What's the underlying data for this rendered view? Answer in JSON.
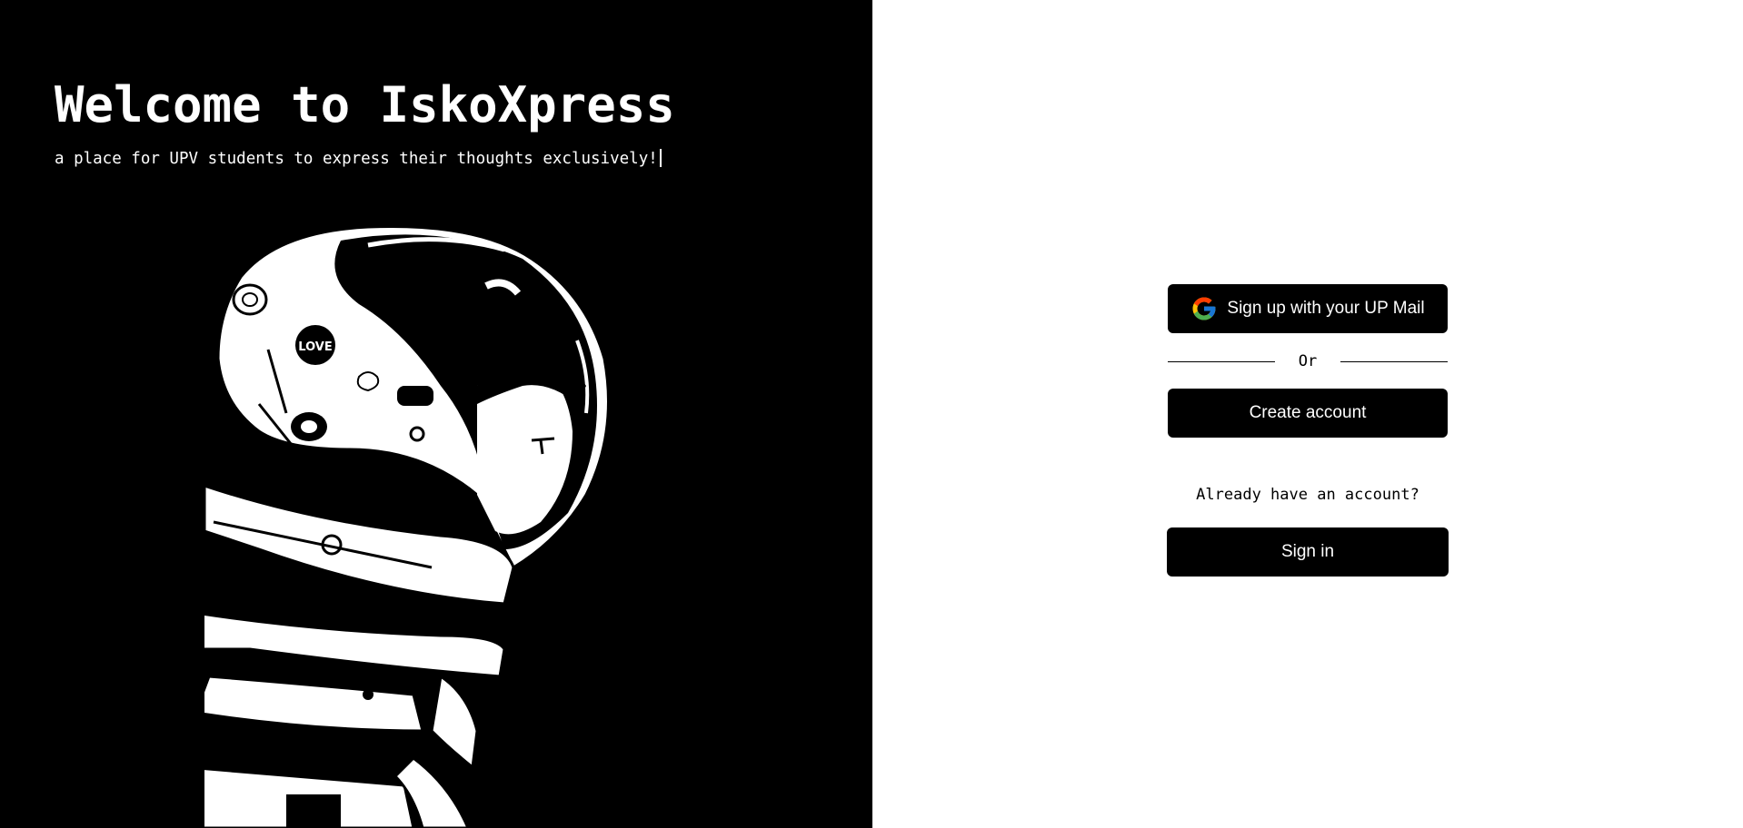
{
  "hero": {
    "title": "Welcome to IskoXpress",
    "subtitle": "a place for UPV students to express their thoughts exclusively!",
    "illustration_text": "LOVE",
    "colors": {
      "background": "#000000",
      "text": "#ffffff"
    }
  },
  "auth": {
    "google_button_label": "Sign up with your UP Mail",
    "google_icon": "google-icon",
    "divider_label": "Or",
    "create_account_label": "Create account",
    "already_have_account_text": "Already have an account?",
    "sign_in_label": "Sign in",
    "colors": {
      "button_bg": "#000000",
      "button_text": "#ffffff",
      "background": "#ffffff"
    }
  }
}
